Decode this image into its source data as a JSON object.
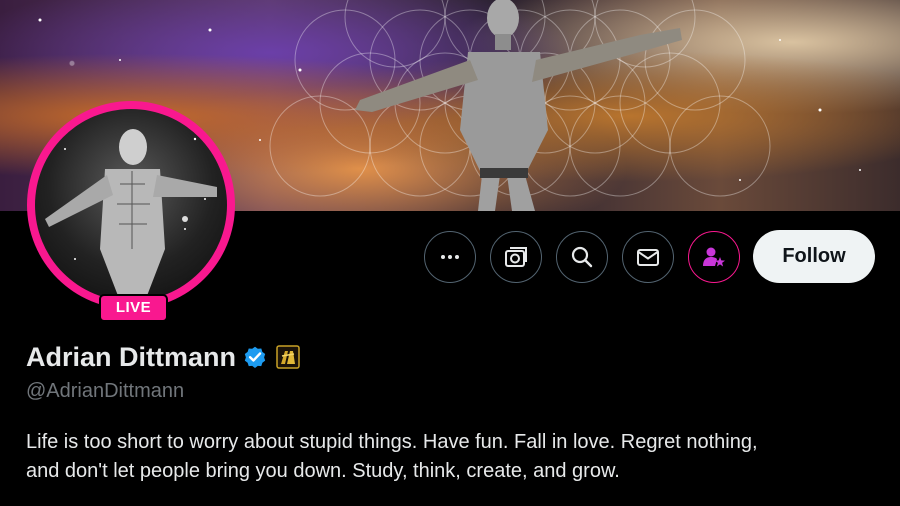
{
  "profile": {
    "live_label": "LIVE",
    "name": "Adrian Dittmann",
    "handle": "@AdrianDittmann",
    "bio_line1": "Life is too short to worry about stupid things. Have fun. Fall in love. Regret nothing,",
    "bio_line2": "and don't let people bring you down. Study, think, create, and grow.",
    "verified_icon": "verified-badge-icon",
    "affiliate_icon": "affiliate-badge-icon"
  },
  "actions": {
    "more_icon": "more-icon",
    "grok_icon": "grok-icon",
    "search_icon": "search-icon",
    "message_icon": "message-icon",
    "subscribe_icon": "subscribe-icon",
    "follow_label": "Follow"
  },
  "colors": {
    "background": "#000000",
    "live_accent": "#f9188f",
    "verified_blue": "#1d9bf0",
    "secondary_text": "#71767b",
    "follow_bg": "#eff3f4"
  }
}
